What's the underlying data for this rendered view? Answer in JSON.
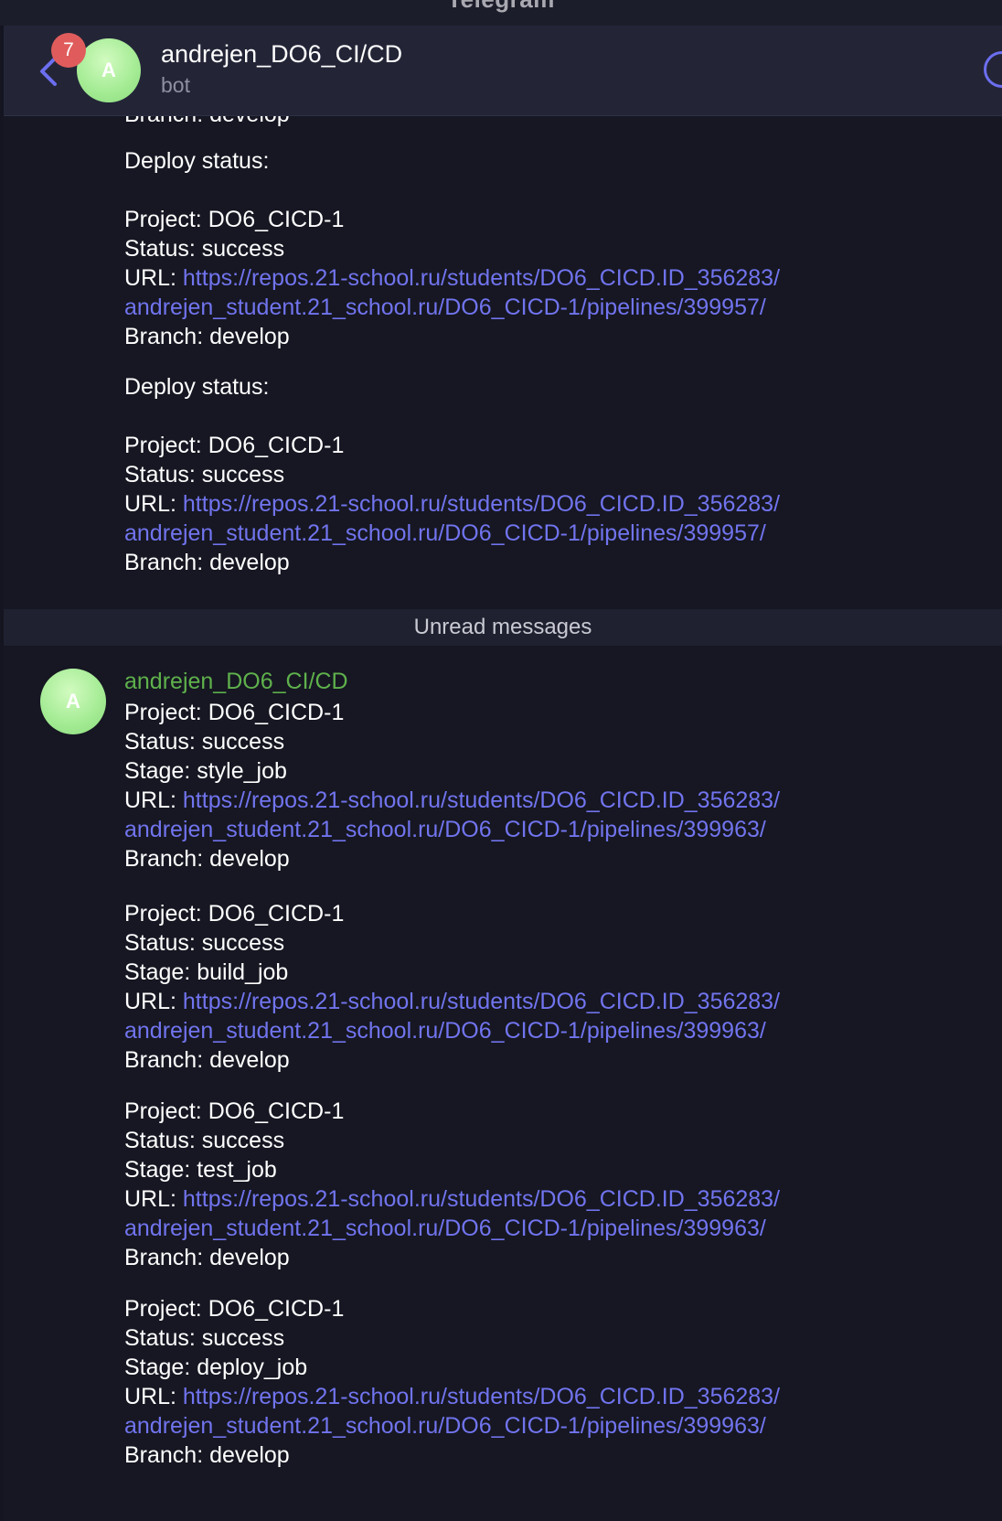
{
  "window": {
    "title": "Telegram"
  },
  "header": {
    "unread_count": "7",
    "avatar_letter": "A",
    "chat_title": "andrejen_DO6_CI/CD",
    "chat_subtitle": "bot"
  },
  "earlier": {
    "partial_line": "Branch: develop",
    "messages": [
      {
        "heading": "Deploy status:",
        "project": "Project: DO6_CICD-1",
        "status": "Status: success",
        "url_label": "URL: ",
        "url_part1": "https://repos.21-school.ru/students/DO6_CICD.ID_356283/",
        "url_part2": "andrejen_student.21_school.ru/DO6_CICD-1/pipelines/399957/",
        "branch": "Branch: develop"
      },
      {
        "heading": "Deploy status:",
        "project": "Project: DO6_CICD-1",
        "status": "Status: success",
        "url_label": "URL: ",
        "url_part1": "https://repos.21-school.ru/students/DO6_CICD.ID_356283/",
        "url_part2": "andrejen_student.21_school.ru/DO6_CICD-1/pipelines/399957/",
        "branch": "Branch: develop"
      }
    ]
  },
  "unread_label": "Unread messages",
  "group": {
    "avatar_letter": "A",
    "sender": "andrejen_DO6_CI/CD",
    "messages": [
      {
        "project": "Project: DO6_CICD-1",
        "status": "Status: success",
        "stage": "Stage: style_job",
        "url_label": "URL: ",
        "url_part1": "https://repos.21-school.ru/students/DO6_CICD.ID_356283/",
        "url_part2": "andrejen_student.21_school.ru/DO6_CICD-1/pipelines/399963/",
        "branch": "Branch: develop"
      },
      {
        "project": "Project: DO6_CICD-1",
        "status": "Status: success",
        "stage": "Stage: build_job",
        "url_label": "URL: ",
        "url_part1": "https://repos.21-school.ru/students/DO6_CICD.ID_356283/",
        "url_part2": "andrejen_student.21_school.ru/DO6_CICD-1/pipelines/399963/",
        "branch": "Branch: develop"
      },
      {
        "project": "Project: DO6_CICD-1",
        "status": "Status: success",
        "stage": "Stage: test_job",
        "url_label": "URL: ",
        "url_part1": "https://repos.21-school.ru/students/DO6_CICD.ID_356283/",
        "url_part2": "andrejen_student.21_school.ru/DO6_CICD-1/pipelines/399963/",
        "branch": "Branch: develop"
      },
      {
        "project": "Project: DO6_CICD-1",
        "status": "Status: success",
        "stage": "Stage: deploy_job",
        "url_label": "URL: ",
        "url_part1": "https://repos.21-school.ru/students/DO6_CICD.ID_356283/",
        "url_part2": "andrejen_student.21_school.ru/DO6_CICD-1/pipelines/399963/",
        "branch": "Branch: develop"
      }
    ]
  },
  "colors": {
    "background": "#161722",
    "header": "#232537",
    "link": "#7174ee",
    "sender_name": "#5fb14c",
    "badge": "#e05c5c",
    "avatar": "#a6ec96"
  }
}
